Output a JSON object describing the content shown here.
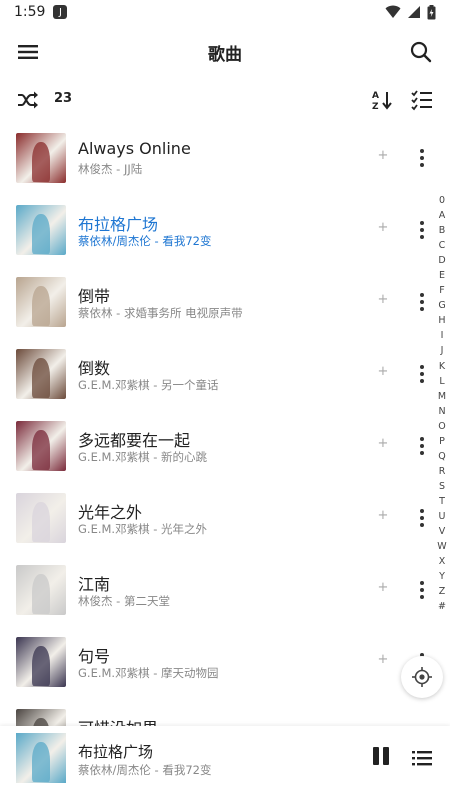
{
  "status_bar": {
    "time": "1:59",
    "app_icon_label": "J"
  },
  "app_bar": {
    "title": "歌曲",
    "menu_icon": "menu-icon",
    "search_icon": "search-icon"
  },
  "toolbar": {
    "song_count": "23",
    "shuffle_icon": "shuffle-icon",
    "sort_icon": "sort-az-icon",
    "select_icon": "checklist-icon"
  },
  "songs": [
    {
      "title": "Always Online",
      "subtitle": "林俊杰 - JJ陆",
      "active": false,
      "cover_color": "#8a2c2c"
    },
    {
      "title": "布拉格广场",
      "subtitle": "蔡依林/周杰伦 - 看我72变",
      "active": true,
      "cover_color": "#5aa9c8"
    },
    {
      "title": "倒带",
      "subtitle": "蔡依林 - 求婚事务所 电视原声带",
      "active": false,
      "cover_color": "#b8a48f"
    },
    {
      "title": "倒数",
      "subtitle": "G.E.M.邓紫棋 - 另一个童话",
      "active": false,
      "cover_color": "#6b4a3a"
    },
    {
      "title": "多远都要在一起",
      "subtitle": "G.E.M.邓紫棋 - 新的心跳",
      "active": false,
      "cover_color": "#7a2a3a"
    },
    {
      "title": "光年之外",
      "subtitle": "G.E.M.邓紫棋 - 光年之外",
      "active": false,
      "cover_color": "#d9d4dc"
    },
    {
      "title": "江南",
      "subtitle": "林俊杰 - 第二天堂",
      "active": false,
      "cover_color": "#c9c9c9"
    },
    {
      "title": "句号",
      "subtitle": "G.E.M.邓紫棋 - 摩天动物园",
      "active": false,
      "cover_color": "#3a3550"
    },
    {
      "title": "可惜没如果",
      "subtitle": "",
      "active": false,
      "cover_color": "#4a4440"
    }
  ],
  "alpha_index": [
    "0",
    "A",
    "B",
    "C",
    "D",
    "E",
    "F",
    "G",
    "H",
    "I",
    "J",
    "K",
    "L",
    "M",
    "N",
    "O",
    "P",
    "Q",
    "R",
    "S",
    "T",
    "U",
    "V",
    "W",
    "X",
    "Y",
    "Z",
    "#"
  ],
  "now_playing": {
    "title": "布拉格广场",
    "subtitle": "蔡依林/周杰伦 - 看我72变",
    "cover_color": "#5aa9c8"
  },
  "row_add_label": "+",
  "colors": {
    "accent": "#1e76d2",
    "primary_text": "#222222",
    "secondary_text": "#888888"
  }
}
